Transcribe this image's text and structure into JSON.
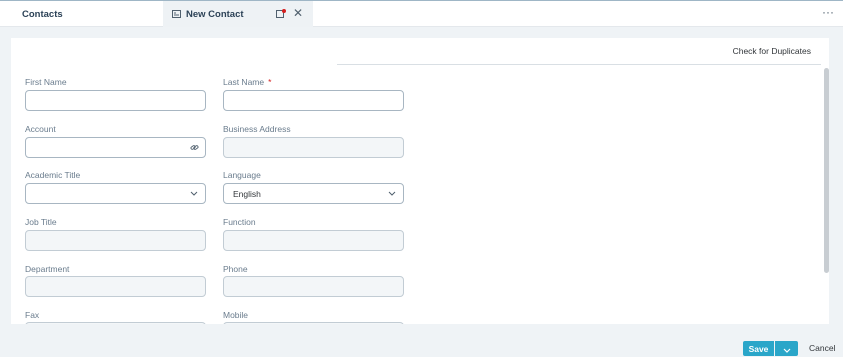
{
  "tabs": {
    "contacts_label": "Contacts",
    "new_contact_label": "New Contact",
    "more_label": "···"
  },
  "form": {
    "check_duplicates_label": "Check for Duplicates",
    "required_marker": "*",
    "fields": {
      "first_name": {
        "label": "First Name",
        "value": ""
      },
      "last_name": {
        "label": "Last Name",
        "value": ""
      },
      "account": {
        "label": "Account",
        "value": ""
      },
      "business_address": {
        "label": "Business Address",
        "value": ""
      },
      "academic_title": {
        "label": "Academic Title",
        "value": ""
      },
      "language": {
        "label": "Language",
        "value": "English"
      },
      "job_title": {
        "label": "Job Title",
        "value": ""
      },
      "function": {
        "label": "Function",
        "value": ""
      },
      "department": {
        "label": "Department",
        "value": ""
      },
      "phone": {
        "label": "Phone",
        "value": ""
      },
      "fax": {
        "label": "Fax",
        "value": ""
      },
      "mobile": {
        "label": "Mobile",
        "value": ""
      }
    }
  },
  "footer": {
    "save_label": "Save",
    "cancel_label": "Cancel"
  },
  "icons": {
    "new_contact_tab": "contact-card-icon",
    "pin": "pin-icon",
    "close": "close-icon",
    "account_link": "link-icon",
    "dropdown": "chevron-down-icon",
    "save_menu": "chevron-down-icon"
  },
  "colors": {
    "accent": "#2aa6c9",
    "required": "#d41e1e"
  }
}
